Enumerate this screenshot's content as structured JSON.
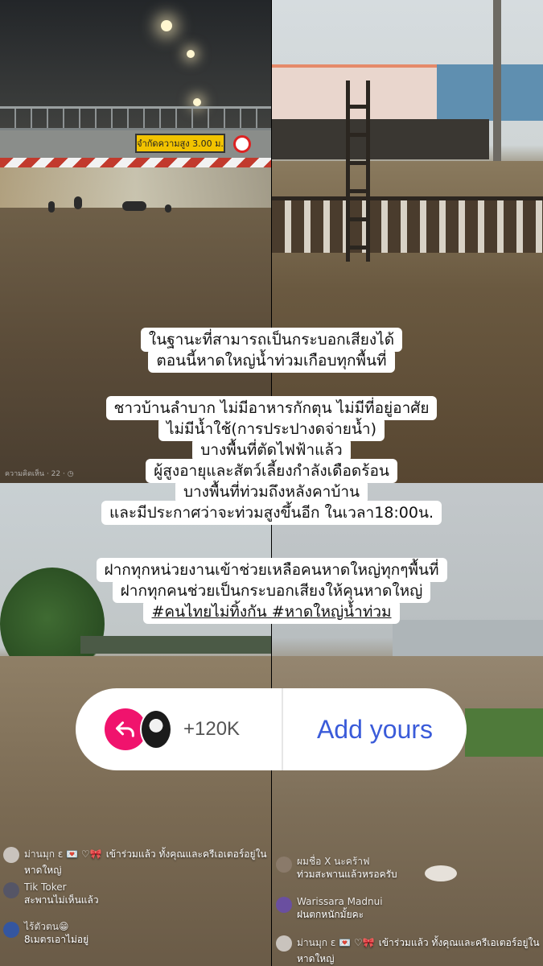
{
  "overlay": {
    "lines1": [
      "ในฐานะที่สามารถเป็นกระบอกเสียงได้",
      "ตอนนี้หาดใหญ่น้ำท่วมเกือบทุกพื้นที่"
    ],
    "lines2": [
      "ชาวบ้านลำบาก ไม่มีอาหารกักตุน ไม่มีที่อยู่อาศัย",
      "ไม่มีน้ำใช้(การประปางดจ่ายน้ำ)",
      "บางพื้นที่ตัดไฟฟ้าแล้ว",
      "ผู้สูงอายุและสัตว์เลี้ยงกำลังเดือดร้อน",
      "บางพื้นที่ท่วมถึงหลังคาบ้าน",
      "และมีประกาศว่าจะท่วมสูงขึ้นอีก ในเวลา18:00น."
    ],
    "lines3": [
      "ฝากทุกหน่วยงานเข้าช่วยเหลือคนหาดใหญ่ทุกๆพื้นที่",
      "ฝากทุกคนช่วยเป็นกระบอกเสียงให้คุนหาดใหญ่",
      "#คนไทยไม่ทิ้งกัน #หาดใหญ่น้ำท่วม"
    ]
  },
  "sign_text": "จำกัดความสูง 3.00 ม.",
  "q1_meta": "ความคิดเห็น · 22 · ◷",
  "add_yours": {
    "count": "+120K",
    "label": "Add yours",
    "accent": "#f0136d",
    "label_color": "#3a5bd9"
  },
  "comments_left": [
    {
      "name": "ม่านมุก ε 💌 ♡🎀",
      "text": "เข้าร่วมแล้ว ทั้งคุณและครีเอเตอร์อยู่ใน หาดใหญ่"
    },
    {
      "name": "Tik Toker",
      "text": "สะพานไม่เห็นแล้ว"
    },
    {
      "name": "ไร้ตัวตน😁",
      "text": "8เมตรเอาไม่อยู่"
    }
  ],
  "comments_right": [
    {
      "name": "ผมชื่อ X นะคร้าฟ",
      "text": "ท่วมสะพานแล้วหรอครับ"
    },
    {
      "name": "Warissara Madnui",
      "text": "ฝนตกหนักมั้ยคะ"
    },
    {
      "name": "ม่านมุก ε 💌 ♡🎀",
      "text": "เข้าร่วมแล้ว ทั้งคุณและครีเอเตอร์อยู่ใน หาดใหญ่"
    }
  ]
}
